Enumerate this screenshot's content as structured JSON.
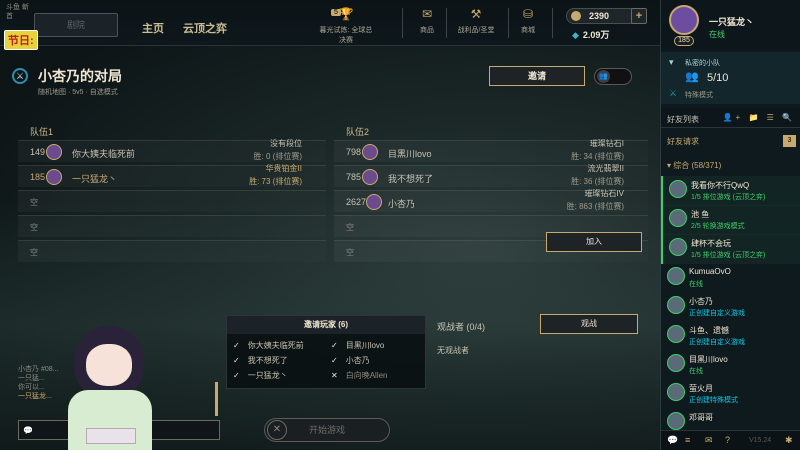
{
  "topbar": {
    "logo_text": "斗鱼 斬首",
    "holiday_badge": "节日:",
    "play_label": "剧院",
    "nav": [
      "主页",
      "云顶之弈"
    ],
    "icons": [
      {
        "badge": "5",
        "label": "暮光试炼: 全球总决赛",
        "icon": "trophy-icon"
      },
      {
        "label": "商品",
        "icon": "loot-icon"
      },
      {
        "label": "战利品/圣堂",
        "icon": "crafting-icon"
      },
      {
        "label": "商城",
        "icon": "store-icon"
      }
    ],
    "rp": "2390",
    "be": "2.09万"
  },
  "lobby": {
    "title": "小杏乃的对局",
    "subtitle": "随机地图 · 5v5 · 自选模式",
    "invite_label": "邀请",
    "team1_label": "队伍1",
    "team2_label": "队伍2",
    "team1": [
      {
        "level": "149",
        "name": "你大姨夫临死前",
        "rank": "没有段位",
        "wins": "胜: 0 (排位赛)",
        "gold": false
      },
      {
        "level": "185",
        "name": "一只猛龙丶",
        "rank": "华贵铂金II",
        "wins": "胜: 73 (排位赛)",
        "gold": true
      },
      {
        "empty": "空"
      },
      {
        "empty": "空"
      },
      {
        "empty": "空"
      }
    ],
    "team2": [
      {
        "level": "798",
        "name": "目黑川lovo",
        "rank": "璀璨钻石I",
        "wins": "胜: 34 (排位赛)"
      },
      {
        "level": "785",
        "name": "我不想死了",
        "rank": "流光翡翠II",
        "wins": "胜: 36 (排位赛)"
      },
      {
        "level": "2627",
        "name": "小杏乃",
        "rank": "璀璨钻石IV",
        "wins": "胜: 863 (排位赛)"
      },
      {
        "empty": "空"
      },
      {
        "empty": "空"
      }
    ],
    "join_label": "加入",
    "invited_title": "邀请玩家 (6)",
    "invited": [
      {
        "mark": "✓",
        "name": "你大姨夫临死前"
      },
      {
        "mark": "✓",
        "name": "目黑川lovo"
      },
      {
        "mark": "✓",
        "name": "我不想死了"
      },
      {
        "mark": "✓",
        "name": "小杏乃"
      },
      {
        "mark": "✓",
        "name": "一只猛龙丶"
      },
      {
        "mark": "✕",
        "name": "白向晚Allen"
      }
    ],
    "spectators": "观战者 (0/4)",
    "spectate_label": "观战",
    "no_spectators": "无观战者",
    "start_label": "开始游戏"
  },
  "chat": {
    "lines": [
      "小杏乃 #08...",
      "一只猛...",
      "你可以...",
      "一只猛龙..."
    ]
  },
  "right": {
    "me_name": "一只猛龙丶",
    "me_status": "在线",
    "me_level": "185",
    "club_title": "私密的小队",
    "club_count": "5/10",
    "club_mode": "特殊模式",
    "friends_title": "好友列表",
    "friend_requests": "好友请求",
    "friend_requests_count": "3",
    "group": "▾ 综合 (58/371)",
    "friends": [
      {
        "name": "我看你不行QwQ",
        "status": "1/5 排位游戏 (云顶之弈)",
        "ingame": true
      },
      {
        "name": "池 鱼",
        "status": "2/5 轮换游戏模式",
        "ingame": true
      },
      {
        "name": "肆杯不会玩",
        "status": "1/5 排位游戏 (云顶之弈)",
        "ingame": true
      },
      {
        "name": "KumuaOvO",
        "status": "在线",
        "ingame": false
      },
      {
        "name": "小杏乃",
        "status": "正创建自定义游戏",
        "ingame": false,
        "active": true
      },
      {
        "name": "斗鱼、遗憾",
        "status": "正创建自定义游戏",
        "ingame": false,
        "active": true
      },
      {
        "name": "目黑川lovo",
        "status": "在线",
        "ingame": false
      },
      {
        "name": "萤火月",
        "status": "正创建特殊模式",
        "ingame": false,
        "active": true
      },
      {
        "name": "邓哥哥",
        "status": "",
        "ingame": false
      }
    ],
    "version": "V15.24"
  }
}
